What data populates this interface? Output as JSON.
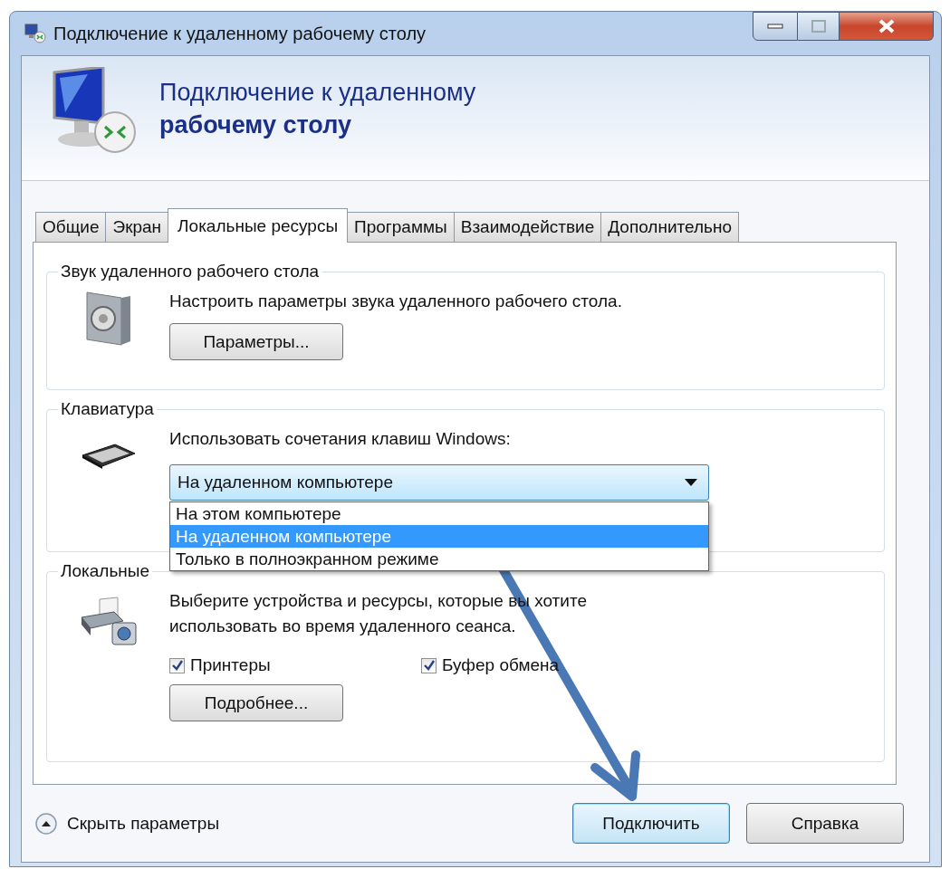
{
  "window": {
    "title": "Подключение к удаленному рабочему столу"
  },
  "header": {
    "line1": "Подключение к удаленному",
    "line2": "рабочему столу"
  },
  "tabs": [
    {
      "label": "Общие",
      "selected": false
    },
    {
      "label": "Экран",
      "selected": false
    },
    {
      "label": "Локальные ресурсы",
      "selected": true
    },
    {
      "label": "Программы",
      "selected": false
    },
    {
      "label": "Взаимодействие",
      "selected": false
    },
    {
      "label": "Дополнительно",
      "selected": false
    }
  ],
  "groups": [
    {
      "kind": "sound",
      "legend": "Звук удаленного рабочего стола",
      "description": "Настроить параметры звука удаленного рабочего стола.",
      "button": "Параметры..."
    },
    {
      "kind": "keyboard",
      "legend": "Клавиатура",
      "label": "Использовать сочетания клавиш Windows:",
      "select": {
        "value": "На удаленном компьютере",
        "expanded": true,
        "options": [
          {
            "label": "На этом компьютере",
            "selected": false
          },
          {
            "label": "На удаленном компьютере",
            "selected": true
          },
          {
            "label": "Только в полноэкранном режиме",
            "selected": false
          }
        ]
      }
    },
    {
      "kind": "devices",
      "legend": "Локальные",
      "description": "Выберите устройства и ресурсы, которые вы хотите использовать во время удаленного сеанса.",
      "checkboxes": [
        {
          "label": "Принтеры",
          "checked": true
        },
        {
          "label": "Буфер обмена",
          "checked": true
        }
      ],
      "button": "Подробнее..."
    }
  ],
  "footer": {
    "toggle": "Скрыть параметры",
    "buttons": [
      {
        "label": "Подключить",
        "default": true
      },
      {
        "label": "Справка",
        "default": false
      }
    ]
  }
}
